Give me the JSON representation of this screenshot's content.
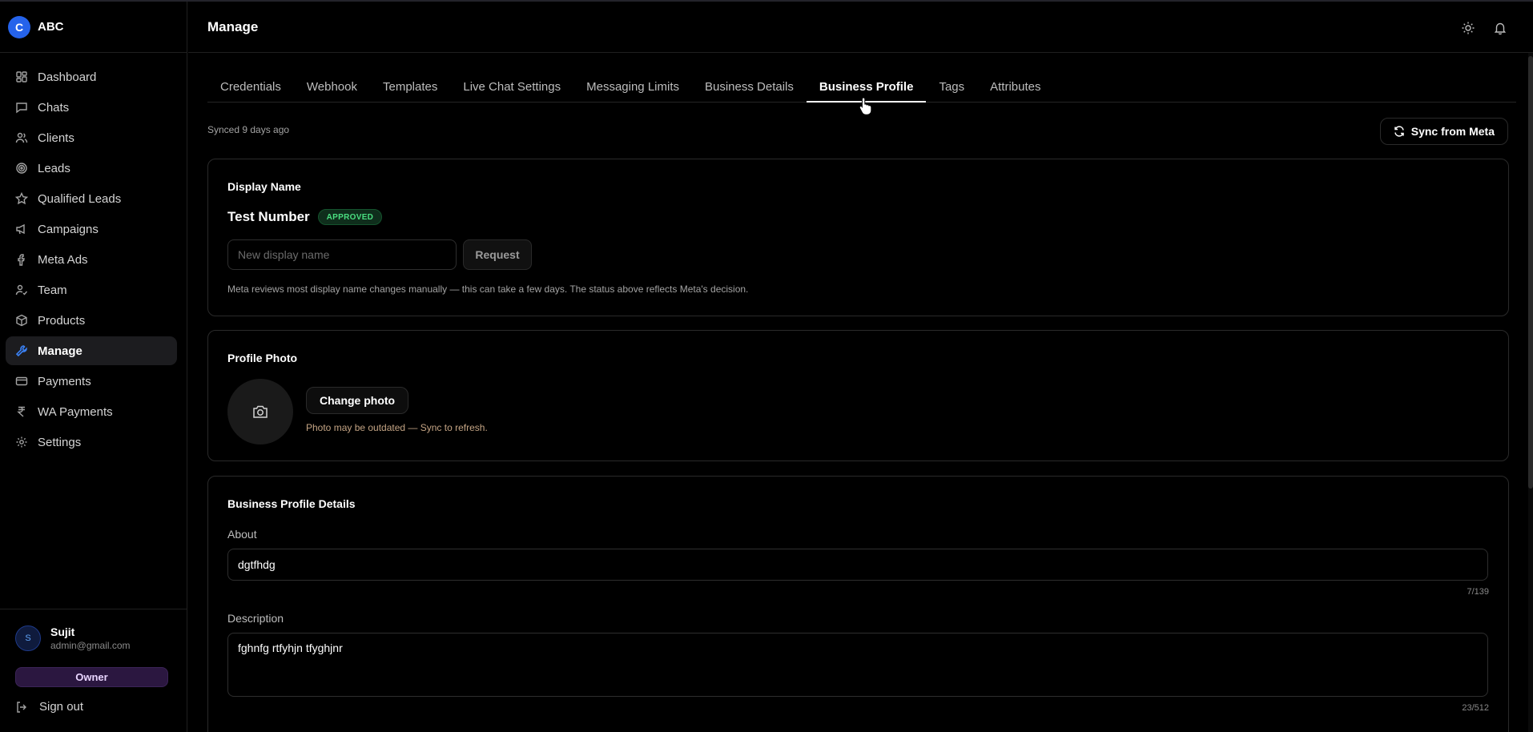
{
  "brand": {
    "logo_letter": "C",
    "name": "ABC"
  },
  "sidebar": {
    "items": [
      {
        "label": "Dashboard",
        "icon": "dashboard-icon"
      },
      {
        "label": "Chats",
        "icon": "chat-icon"
      },
      {
        "label": "Clients",
        "icon": "users-icon"
      },
      {
        "label": "Leads",
        "icon": "target-icon"
      },
      {
        "label": "Qualified Leads",
        "icon": "star-icon"
      },
      {
        "label": "Campaigns",
        "icon": "megaphone-icon"
      },
      {
        "label": "Meta Ads",
        "icon": "facebook-icon"
      },
      {
        "label": "Team",
        "icon": "user-check-icon"
      },
      {
        "label": "Products",
        "icon": "box-icon"
      },
      {
        "label": "Manage",
        "icon": "wrench-icon",
        "active": true
      },
      {
        "label": "Payments",
        "icon": "credit-card-icon"
      },
      {
        "label": "WA Payments",
        "icon": "rupee-icon"
      },
      {
        "label": "Settings",
        "icon": "gear-icon"
      }
    ]
  },
  "user": {
    "initial": "S",
    "name": "Sujit",
    "email": "admin@gmail.com",
    "role": "Owner",
    "signout_label": "Sign out"
  },
  "header": {
    "title": "Manage",
    "icons": [
      "sun-icon",
      "bell-icon"
    ]
  },
  "tabs": [
    {
      "label": "Credentials"
    },
    {
      "label": "Webhook"
    },
    {
      "label": "Templates"
    },
    {
      "label": "Live Chat Settings"
    },
    {
      "label": "Messaging Limits"
    },
    {
      "label": "Business Details"
    },
    {
      "label": "Business Profile",
      "active": true
    },
    {
      "label": "Tags"
    },
    {
      "label": "Attributes"
    }
  ],
  "sync": {
    "status": "Synced 9 days ago",
    "button_label": "Sync from Meta"
  },
  "display_name": {
    "title": "Display Name",
    "value": "Test Number",
    "status": "APPROVED",
    "status_color": "#4ade80",
    "input_placeholder": "New display name",
    "request_label": "Request",
    "helper": "Meta reviews most display name changes manually — this can take a few days. The status above reflects Meta's decision."
  },
  "profile_photo": {
    "title": "Profile Photo",
    "change_label": "Change photo",
    "note": "Photo may be outdated — Sync to refresh."
  },
  "business_profile": {
    "title": "Business Profile Details",
    "about_label": "About",
    "about_value": "dgtfhdg",
    "about_count": "7/139",
    "description_label": "Description",
    "description_value": "fghnfg rtfyhjn tfyghjnr",
    "description_count": "23/512"
  },
  "colors": {
    "accent": "#2563eb",
    "active_icon": "#3b82f6",
    "role_badge_bg": "#2b1740"
  }
}
